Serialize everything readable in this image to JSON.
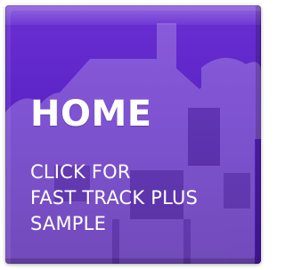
{
  "tile": {
    "title": "HOME",
    "subtitle_lines": [
      "CLICK FOR",
      "FAST TRACK PLUS",
      "SAMPLE"
    ],
    "accent_color": "#5a22c4",
    "text_color": "#ffffff"
  }
}
